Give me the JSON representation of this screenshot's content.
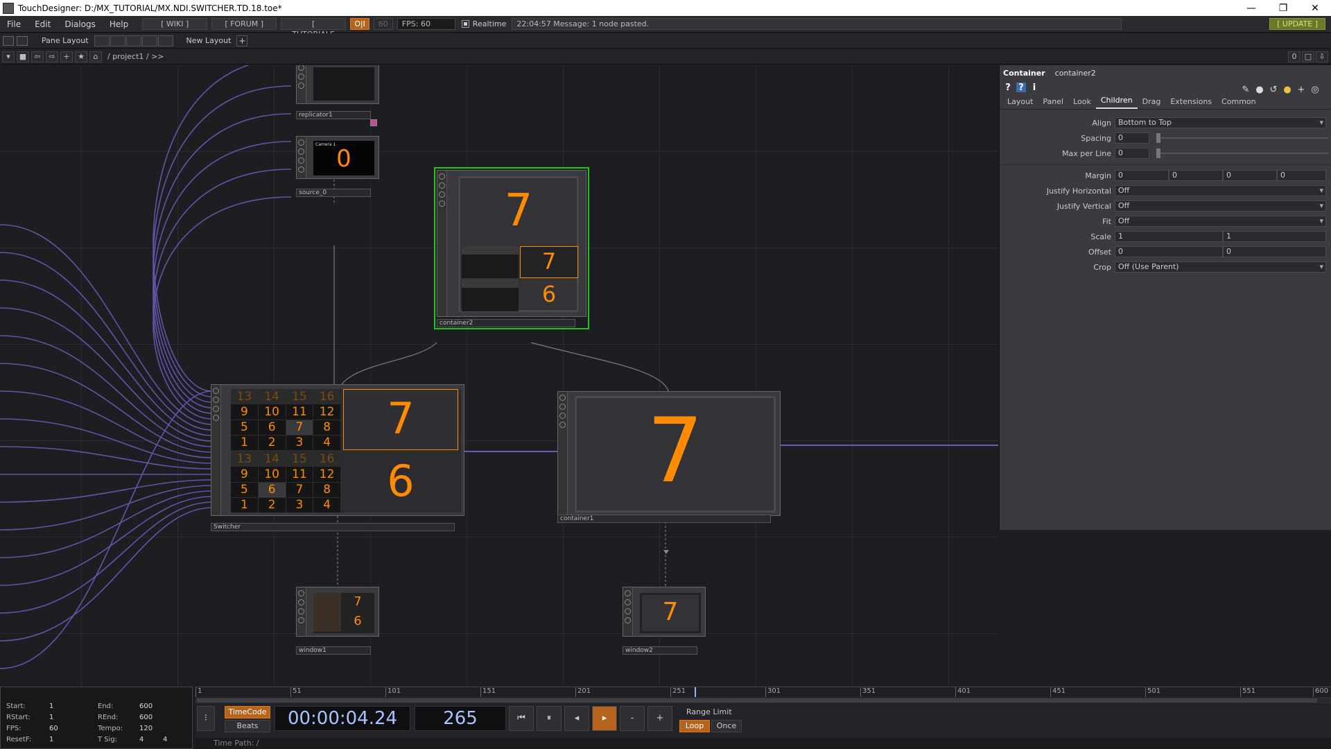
{
  "window": {
    "title": "TouchDesigner: D:/MX_TUTORIAL/MX.NDI.SWITCHER.TD.18.toe*",
    "minimize": "—",
    "restore": "❐",
    "close": "✕"
  },
  "menubar": {
    "items": [
      "File",
      "Edit",
      "Dialogs",
      "Help"
    ],
    "wiki": "[ WIKI ]",
    "forum": "[ FORUM ]",
    "tutorials": "[ TUTORIALS ]",
    "ok": "O|I",
    "fps_target": "60",
    "fps": "FPS:  60",
    "realtime": "Realtime",
    "message": "22:04:57 Message: 1 node pasted.",
    "update": "[ UPDATE ]"
  },
  "panebar": {
    "pane_layout": "Pane Layout",
    "new_layout": "New Layout"
  },
  "pathbar": {
    "path": "/ project1 / >>",
    "zero": "0"
  },
  "nodes": {
    "replicator": {
      "label": "replicator1"
    },
    "source": {
      "label": "source_0",
      "value": "0",
      "caption": "Camera 1"
    },
    "container2": {
      "label": "container2",
      "big": "7",
      "small_top": "7",
      "small_bottom": "6"
    },
    "switcher": {
      "label": "Switcher",
      "big_top": "7",
      "big_bottom": "6",
      "grid_top": [
        "13",
        "14",
        "15",
        "16",
        "9",
        "10",
        "11",
        "12",
        "5",
        "6",
        "7",
        "8",
        "1",
        "2",
        "3",
        "4"
      ],
      "grid_bottom": [
        "13",
        "14",
        "15",
        "16",
        "9",
        "10",
        "11",
        "12",
        "5",
        "6",
        "7",
        "8",
        "1",
        "2",
        "3",
        "4"
      ]
    },
    "container1": {
      "label": "container1",
      "big": "7"
    },
    "window1": {
      "label": "window1",
      "top": "7",
      "bottom": "6"
    },
    "window2": {
      "label": "window2",
      "big": "7"
    }
  },
  "params": {
    "type": "Container",
    "name": "container2",
    "tabs": [
      "Layout",
      "Panel",
      "Look",
      "Children",
      "Drag",
      "Extensions",
      "Common"
    ],
    "active_tab": "Children",
    "rows": {
      "align": {
        "label": "Align",
        "value": "Bottom to Top"
      },
      "spacing": {
        "label": "Spacing",
        "value": "0"
      },
      "max_per_line": {
        "label": "Max per Line",
        "value": "0"
      },
      "margin": {
        "label": "Margin",
        "values": [
          "0",
          "0",
          "0",
          "0"
        ]
      },
      "justify_h": {
        "label": "Justify Horizontal",
        "value": "Off"
      },
      "justify_v": {
        "label": "Justify Vertical",
        "value": "Off"
      },
      "fit": {
        "label": "Fit",
        "value": "Off"
      },
      "scale": {
        "label": "Scale",
        "values": [
          "1",
          "1"
        ]
      },
      "offset": {
        "label": "Offset",
        "values": [
          "0",
          "0"
        ]
      },
      "crop": {
        "label": "Crop",
        "value": "Off (Use Parent)"
      }
    }
  },
  "timeline": {
    "ticks": [
      "1",
      "51",
      "101",
      "151",
      "201",
      "251",
      "301",
      "351",
      "401",
      "451",
      "501",
      "551",
      "600"
    ],
    "start_label": "Start:",
    "start": "1",
    "rstart_label": "RStart:",
    "rstart": "1",
    "fps_label": "FPS:",
    "fps": "60",
    "resetf_label": "ResetF:",
    "resetf": "1",
    "end_label": "End:",
    "end": "600",
    "rend_label": "REnd:",
    "rend": "600",
    "tempo_label": "Tempo:",
    "tempo": "120",
    "tsig_label": "T Sig:",
    "tsig_a": "4",
    "tsig_b": "4",
    "timecode_btn": "TimeCode",
    "beats_btn": "Beats",
    "timecode": "00:00:04.24",
    "frame": "265",
    "range_limit": "Range Limit",
    "loop": "Loop",
    "once": "Once",
    "time_path": "Time Path: /"
  },
  "colors": {
    "accent": "#ff8c00",
    "selected": "#1ec81e",
    "wire": "#6a5ab8"
  }
}
